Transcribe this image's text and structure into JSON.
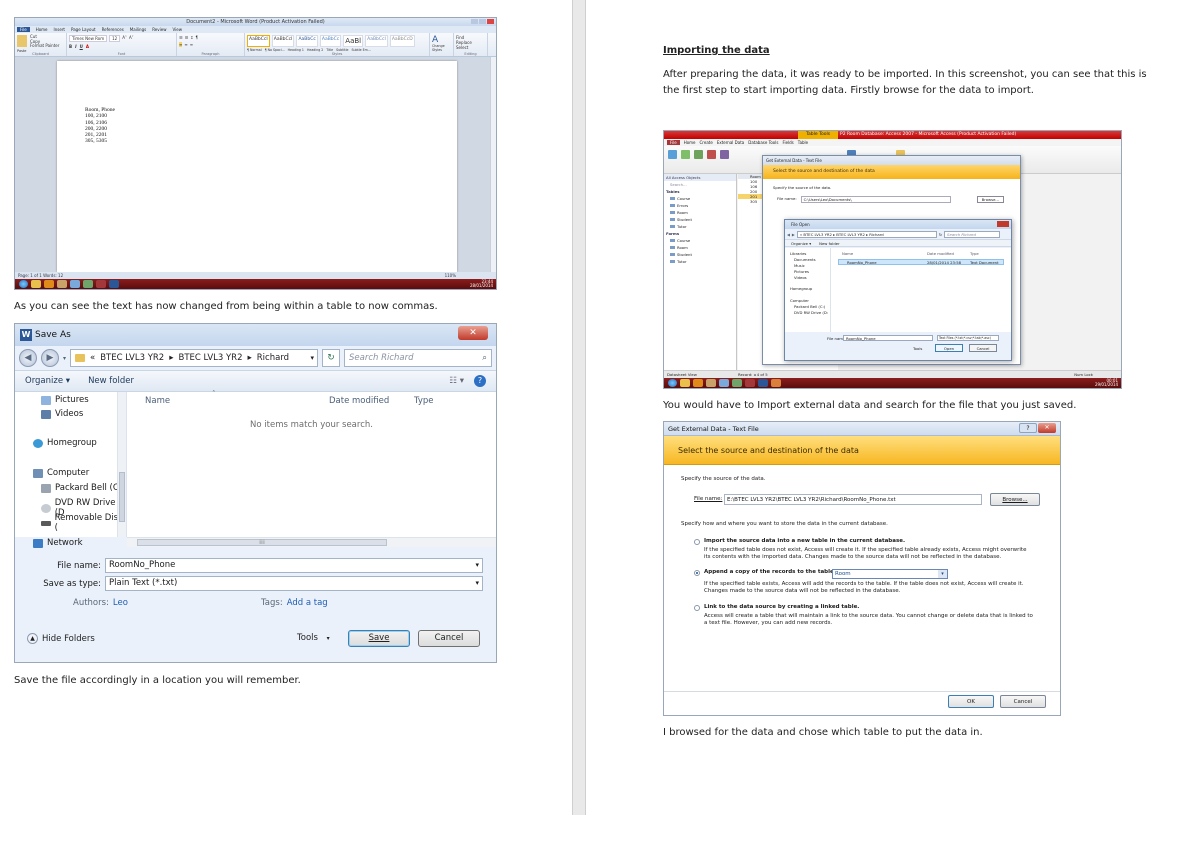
{
  "word_shot": {
    "title": "Document2 - Microsoft Word (Product Activation Failed)",
    "tabs": [
      "File",
      "Home",
      "Insert",
      "Page Layout",
      "References",
      "Mailings",
      "Review",
      "View"
    ],
    "clipboard": [
      "Cut",
      "Copy",
      "Format Painter"
    ],
    "paste_label": "Paste",
    "font_name": "Times New Rom",
    "font_size": "12",
    "group_labels": [
      "Clipboard",
      "Font",
      "Paragraph",
      "Styles",
      "Editing"
    ],
    "styles": [
      "AaBbCcI",
      "AaBbCcI",
      "AaBbCc",
      "AaBbCc",
      "AaBl",
      "AaBbCcI",
      "AaBbCcD"
    ],
    "style_names": [
      "¶ Normal",
      "¶ No Spaci...",
      "Heading 1",
      "Heading 2",
      "Title",
      "Subtitle",
      "Subtle Em..."
    ],
    "change_styles": "Change Styles",
    "editing": [
      "Find",
      "Replace",
      "Select"
    ],
    "doc_lines": [
      "Room, Phone",
      "100, 2100",
      "106, 2106",
      "200, 2200",
      "201, 2201",
      "305, 5305"
    ],
    "status": "Page: 1 of 1   Words: 12",
    "zoom": "110%",
    "clock_time": "23:44",
    "clock_date": "28/01/2014"
  },
  "caption_1": "As you can see the text has now changed from being within a table to now commas.",
  "save_as": {
    "title": "Save As",
    "close": "✕",
    "breadcrumb": [
      "«",
      "BTEC LVL3 YR2",
      "BTEC LVL3 YR2",
      "Richard"
    ],
    "search_placeholder": "Search Richard",
    "organize": "Organize ▾",
    "new_folder": "New folder",
    "tree": [
      "Pictures",
      "Videos",
      "Homegroup",
      "Computer",
      "Packard Bell (C:)",
      "DVD RW Drive (D",
      "Removable Disk (",
      "Network"
    ],
    "columns": [
      "Name",
      "Date modified",
      "Type"
    ],
    "empty_message": "No items match your search.",
    "file_name_label": "File name:",
    "file_name_value": "RoomNo_Phone",
    "save_type_label": "Save as type:",
    "save_type_value": "Plain Text (*.txt)",
    "authors_label": "Authors:",
    "authors_value": "Leo",
    "tags_label": "Tags:",
    "tags_value": "Add a tag",
    "hide_folders": "Hide Folders",
    "tools": "Tools",
    "save_button": "Save",
    "cancel_button": "Cancel"
  },
  "caption_2": "Save the file accordingly in a location you will remember.",
  "right_heading": "Importing the data",
  "right_paragraph": "After preparing the data, it was ready to be imported.  In this screenshot, you can see that this is the first step to start importing data. Firstly browse for the data to import.",
  "access_shot": {
    "title": "P2 Room Database: Access 2007 - Microsoft Access (Product Activation Failed)",
    "table_tools": "Table Tools",
    "tabs": [
      "File",
      "Home",
      "Create",
      "External Data",
      "Database Tools",
      "Fields",
      "Table"
    ],
    "nav_header": "All Access Objects",
    "nav_search": "Search...",
    "tables_header": "Tables",
    "tables": [
      "Course",
      "Errors",
      "Room",
      "Student",
      "Tutor"
    ],
    "forms_header": "Forms",
    "forms": [
      "Course",
      "Room",
      "Student",
      "Tutor"
    ],
    "room_column": "Room",
    "room_values": [
      "100",
      "106",
      "200",
      "201",
      "305"
    ],
    "ged_title": "Get External Data - Text File",
    "ged_band": "Select the source and destination of the data",
    "ged_specify": "Specify the source of the data.",
    "ged_file_label": "File name:",
    "ged_file_value": "C:\\Users\\Leo\\Documents\\",
    "ged_browse": "Browse...",
    "fo_title": "File Open",
    "fo_path": "« BTEC LVL3 YR2 ▸ BTEC LVL3 YR2 ▸ Richard",
    "fo_search": "Search Richard",
    "fo_organize": "Organize ▾",
    "fo_newfolder": "New folder",
    "fo_tree": [
      "Libraries",
      "Documents",
      "Music",
      "Pictures",
      "Videos",
      "Homegroup",
      "Computer",
      "Packard Bell (C:)",
      "DVD RW Drive (D:"
    ],
    "fo_columns": [
      "Name",
      "Date modified",
      "Type"
    ],
    "fo_file_name": "RoomNo_Phone",
    "fo_file_date": "28/01/2014 23:58",
    "fo_file_type": "Text Document",
    "fo_filename_label": "File name:",
    "fo_filename_value": "RoomNo_Phone",
    "fo_filter": "Text Files (*.txt;*.csv;*.tab;*.asc)",
    "fo_tools": "Tools",
    "fo_open": "Open",
    "fo_cancel": "Cancel",
    "status": "Datasheet View",
    "record_nav": "Record: ◂ 4 of 5",
    "num_lock": "Num Lock",
    "clock_time": "00:01",
    "clock_date": "29/01/2014"
  },
  "caption_3": "You would have to Import external data and search for the file that you just saved.",
  "get_ext": {
    "title": "Get External Data - Text File",
    "help": "?",
    "close": "✕",
    "band": "Select the source and destination of the data",
    "specify_source": "Specify the source of the data.",
    "file_label": "File name:",
    "file_value": "E:\\BTEC LVL3 YR2\\BTEC LVL3 YR2\\Richard\\RoomNo_Phone.txt",
    "browse": "Browse...",
    "specify_dest": "Specify how and where you want to store the data in the current database.",
    "opt1_title": "Import the source data into a new table in the current database.",
    "opt1_desc": "If the specified table does not exist, Access will create it. If the specified table already exists, Access might overwrite its contents with the imported data. Changes made to the source data will not be reflected in the database.",
    "opt2_title": "Append a copy of the records to the table:",
    "opt2_table": "Room",
    "opt2_desc": "If the specified table exists, Access will add the records to the table. If the table does not exist, Access will create it. Changes made to the source data will not be reflected in the database.",
    "opt3_title": "Link to the data source by creating a linked table.",
    "opt3_desc": "Access will create a table that will maintain a link to the source data. You cannot change or delete data that is linked to a text file. However, you can add new records.",
    "ok": "OK",
    "cancel": "Cancel"
  },
  "caption_4": "I browsed for the data and chose which table to put the data in."
}
